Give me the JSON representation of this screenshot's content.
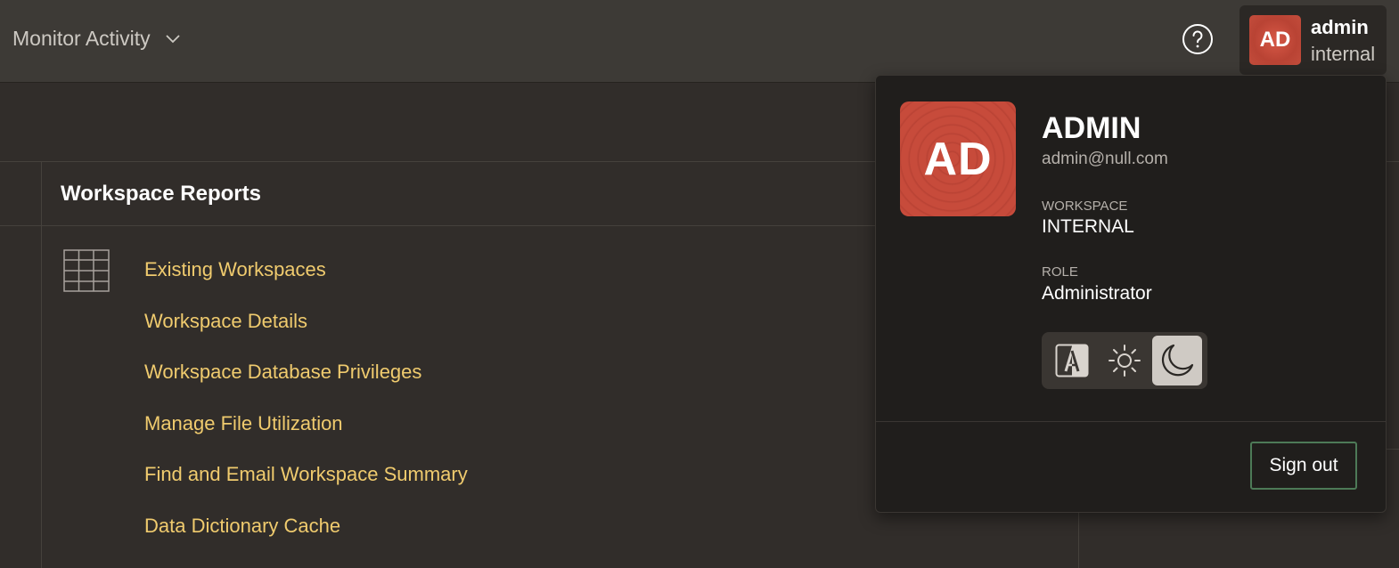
{
  "header": {
    "nav_title": "Monitor Activity",
    "user_initials": "AD",
    "user_name": "admin",
    "user_workspace": "internal"
  },
  "region": {
    "title": "Workspace Reports",
    "links": [
      "Existing Workspaces",
      "Workspace Details",
      "Workspace Database Privileges",
      "Manage File Utilization",
      "Find and Email Workspace Summary",
      "Data Dictionary Cache"
    ]
  },
  "user_menu": {
    "initials": "AD",
    "name": "ADMIN",
    "email": "admin@null.com",
    "workspace_label": "WORKSPACE",
    "workspace_value": "INTERNAL",
    "role_label": "ROLE",
    "role_value": "Administrator",
    "theme_options": [
      "auto-icon",
      "light-sun-icon",
      "dark-moon-icon"
    ],
    "selected_theme": "dark",
    "sign_out_label": "Sign out"
  },
  "colors": {
    "link": "#f0cb6e",
    "avatar": "#c74b3b",
    "signout_border": "#4d7a57",
    "background": "#312d2a",
    "header": "#3d3a36"
  }
}
